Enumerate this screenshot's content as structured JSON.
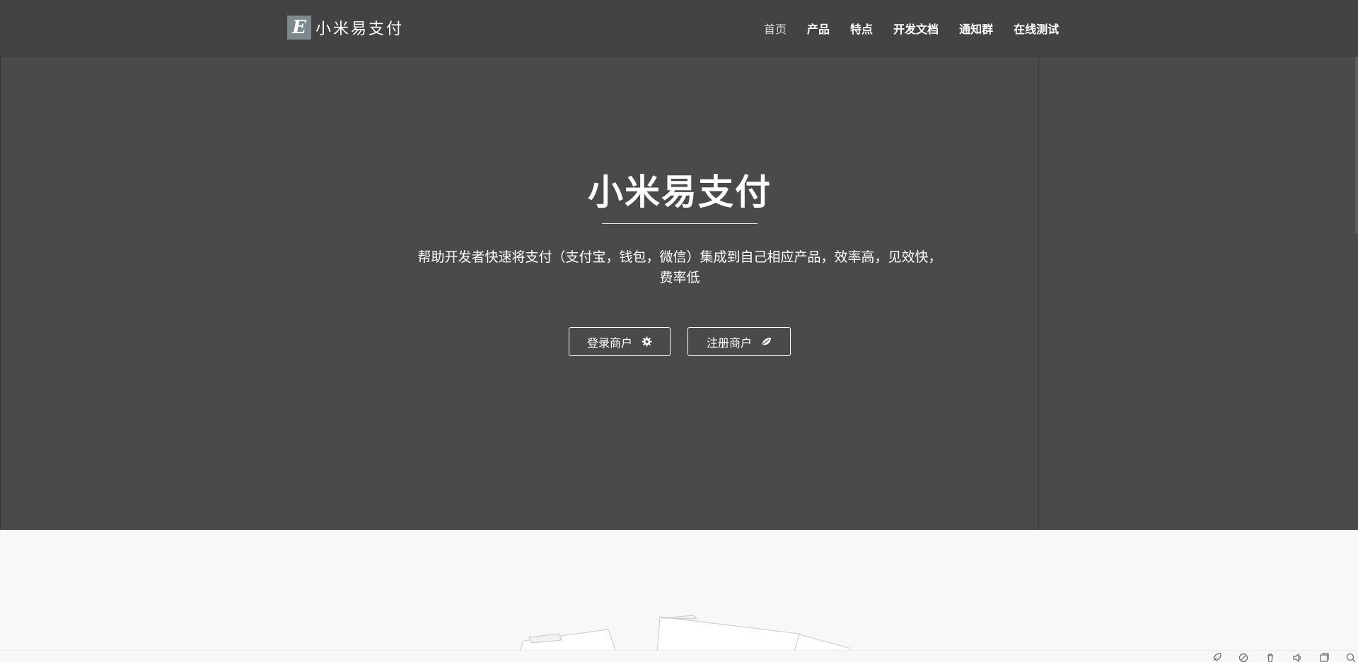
{
  "brand": {
    "logo_letter": "E",
    "name": "小米易支付"
  },
  "nav": {
    "items": [
      {
        "label": "首页",
        "active": true
      },
      {
        "label": "产品"
      },
      {
        "label": "特点"
      },
      {
        "label": "开发文档"
      },
      {
        "label": "通知群"
      },
      {
        "label": "在线测试"
      }
    ]
  },
  "hero": {
    "title": "小米易支付",
    "subtitle": "帮助开发者快速将支付（支付宝，钱包，微信）集成到自己相应产品，效率高，见效快，费率低",
    "login_button": "登录商户",
    "login_icon": "gear-icon",
    "register_button": "注册商户",
    "register_icon": "leaf-icon"
  },
  "bottom_bar": {
    "icons": [
      "rocket-icon",
      "edit-icon",
      "trash-icon",
      "speaker-icon",
      "window-icon",
      "search-icon"
    ]
  },
  "colors": {
    "hero_bg": "#4a4a4a",
    "navbar_bg": "#434343",
    "logo_bg": "#7c8a8c",
    "section_bg": "#f8f8f8"
  }
}
